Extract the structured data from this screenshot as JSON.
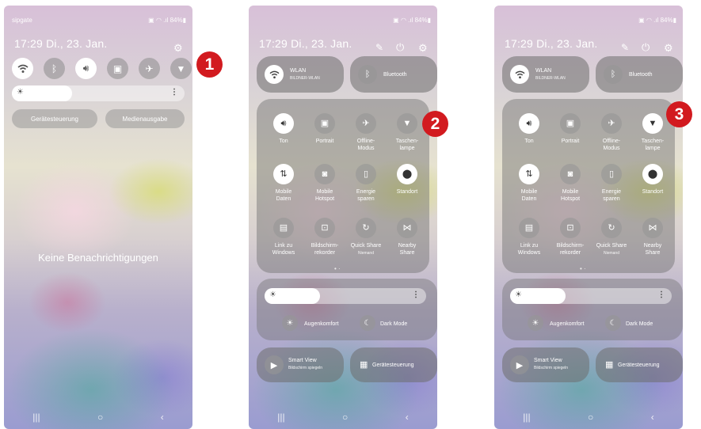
{
  "phone1": {
    "carrier": "sipgate",
    "status_icons": "▣ ◠ .ıl 84%▮",
    "time_date": "17:29 Di., 23. Jan.",
    "quick_icons": [
      "wifi-icon",
      "bluetooth-icon",
      "sound-icon",
      "portrait-icon",
      "airplane-icon",
      "flashlight-icon"
    ],
    "devices_label": "Gerätesteuerung",
    "media_label": "Medienausgabe",
    "empty_message": "Keine Benachrichtigungen"
  },
  "panel": {
    "time_date": "17:29 Di., 23. Jan.",
    "status_icons": "▣ ◠ .ıl 84%▮",
    "wlan_label": "WLAN",
    "wlan_network": "BILDNER-WLAN",
    "bluetooth_label": "Bluetooth",
    "tiles": [
      {
        "line1": "Ton",
        "line2": "",
        "sub": ""
      },
      {
        "line1": "Portrait",
        "line2": "",
        "sub": ""
      },
      {
        "line1": "Offline-",
        "line2": "Modus",
        "sub": ""
      },
      {
        "line1": "Taschen-",
        "line2": "lampe",
        "sub": ""
      },
      {
        "line1": "Mobile",
        "line2": "Daten",
        "sub": ""
      },
      {
        "line1": "Mobile",
        "line2": "Hotspot",
        "sub": ""
      },
      {
        "line1": "Energie",
        "line2": "sparen",
        "sub": ""
      },
      {
        "line1": "Standort",
        "line2": "",
        "sub": ""
      },
      {
        "line1": "Link zu",
        "line2": "Windows",
        "sub": ""
      },
      {
        "line1": "Bildschirm-",
        "line2": "rekorder",
        "sub": ""
      },
      {
        "line1": "Quick Share",
        "line2": "",
        "sub": "Niemand"
      },
      {
        "line1": "Nearby",
        "line2": "Share",
        "sub": ""
      }
    ],
    "eye_comfort_label": "Augenkomfort",
    "dark_mode_label": "Dark Mode",
    "smart_view_label": "Smart View",
    "smart_view_sub": "Bildschirm spiegeln",
    "device_control_label": "Gerätesteuerung"
  },
  "badges": [
    "1",
    "2",
    "3"
  ],
  "colors": {
    "badge": "#d21a1f",
    "active_tile": "#ffffff"
  }
}
